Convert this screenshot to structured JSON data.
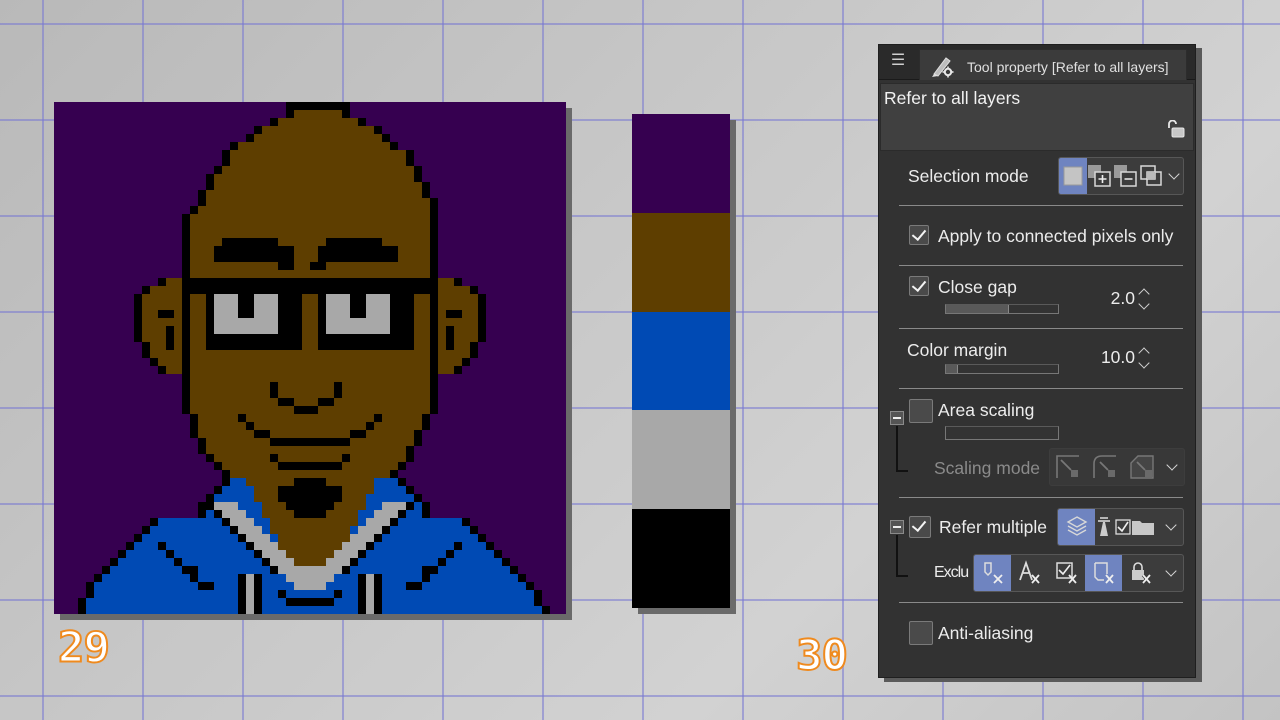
{
  "canvas": {
    "background_color": "#c4c4c4",
    "grid_color": "#8c8cd2"
  },
  "steps": {
    "left": "29",
    "right": "30",
    "color": "#ef8a1e"
  },
  "artwork": {
    "description": "pixel-art portrait of a bald man with glasses and blue hoodie",
    "colors": {
      "background": "#360050",
      "skin": "#5e3e00",
      "hoodie": "#004ab4",
      "grey": "#a8a8a8",
      "outline": "#000000"
    }
  },
  "palette": {
    "swatches": [
      {
        "name": "purple",
        "color": "#360050"
      },
      {
        "name": "brown",
        "color": "#5e3e00"
      },
      {
        "name": "blue",
        "color": "#004ab4"
      },
      {
        "name": "grey",
        "color": "#a8a8a8"
      },
      {
        "name": "black",
        "color": "#000000"
      }
    ]
  },
  "panel": {
    "menu_icon": "hamburger-icon",
    "tab_icon": "pen-gear-icon",
    "tab_title": "Tool property [Refer to all layers]",
    "preset_name": "Refer to all layers",
    "lock_icon": "unlock-icon",
    "selection_mode": {
      "label": "Selection mode",
      "options": [
        "new-selection",
        "add-selection",
        "subtract-selection",
        "intersect-selection"
      ],
      "active": "new-selection"
    },
    "apply_connected": {
      "label": "Apply to connected pixels only",
      "checked": true
    },
    "close_gap": {
      "label": "Close gap",
      "checked": true,
      "value": "2.0",
      "slider_fraction": 0.55
    },
    "color_margin": {
      "label": "Color margin",
      "value": "10.0",
      "slider_fraction": 0.1
    },
    "area_scaling": {
      "label": "Area scaling",
      "checked": false,
      "slider_fraction": 0
    },
    "scaling_mode": {
      "label": "Scaling mode",
      "options": [
        "scale-square",
        "scale-round",
        "scale-bevel"
      ],
      "enabled": false
    },
    "refer_multiple": {
      "label": "Refer multiple",
      "checked": true,
      "options": [
        "all-layers",
        "reference-layer",
        "selected-layers",
        "folder-layers"
      ],
      "active": "all-layers"
    },
    "exclude": {
      "label": "Exclu",
      "options": [
        "exclude-draft",
        "exclude-text",
        "exclude-edit",
        "exclude-paper",
        "exclude-locked"
      ],
      "active": [
        "exclude-draft",
        "exclude-paper"
      ]
    },
    "anti_aliasing": {
      "label": "Anti-aliasing",
      "checked": false
    }
  }
}
